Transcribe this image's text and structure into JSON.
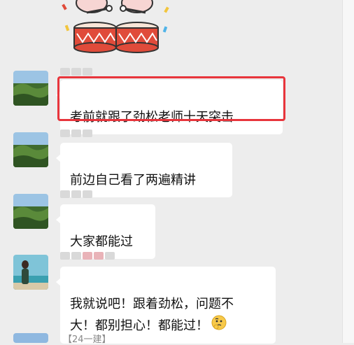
{
  "messages": [
    {
      "text": "考前就跟了劲松老师十天突击"
    },
    {
      "text": "前边自己看了两遍精讲"
    },
    {
      "text": "大家都能过"
    },
    {
      "text": "我就说吧！跟着劲松，问题不\n大！都别担心！都能过！",
      "emoji": "thinking-face-icon"
    }
  ],
  "group_tag": "【24一建】",
  "colors": {
    "highlight": "#e8353c",
    "background": "#ededed",
    "bubble": "#ffffff"
  }
}
